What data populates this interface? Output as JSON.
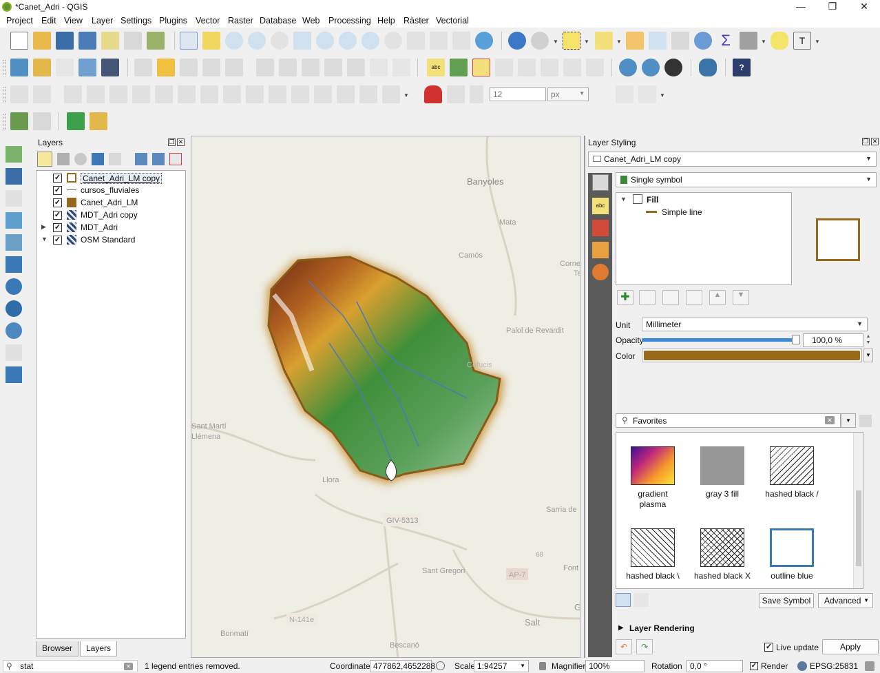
{
  "window": {
    "title": "*Canet_Adri - QGIS",
    "controls": {
      "minimize": "—",
      "restore": "❐",
      "close": "✕"
    }
  },
  "menubar": {
    "items": [
      "Project",
      "Edit",
      "View",
      "Layer",
      "Settings",
      "Plugins",
      "Vector",
      "Raster",
      "Database",
      "Web",
      "Processing",
      "Help",
      "Ràster",
      "Vectorial"
    ]
  },
  "digitizing": {
    "snap_tolerance": "12",
    "snap_unit": "px"
  },
  "layers_panel": {
    "title": "Layers",
    "items": [
      {
        "name": "Canet_Adri_LM copy",
        "checked": true,
        "symbol": "outline-brown",
        "expand": ""
      },
      {
        "name": "cursos_fluviales",
        "checked": true,
        "symbol": "line",
        "expand": ""
      },
      {
        "name": "Canet_Adri_LM",
        "checked": true,
        "symbol": "fill-brown",
        "expand": ""
      },
      {
        "name": "MDT_Adri copy",
        "checked": true,
        "symbol": "raster",
        "expand": ""
      },
      {
        "name": "MDT_Adri",
        "checked": true,
        "symbol": "raster",
        "expand": "▶"
      },
      {
        "name": "OSM Standard",
        "checked": true,
        "symbol": "raster",
        "expand": "▼"
      }
    ],
    "tabs": [
      "Browser",
      "Layers"
    ]
  },
  "map": {
    "labels": [
      "Banyoles",
      "Mata",
      "Camós",
      "Corne",
      "Te",
      "Palol de Revardit",
      "Sant Martí",
      "Llémena",
      "Llora",
      "GIV-5313",
      "Sarria de",
      "68",
      "AP-7",
      "Font",
      "Sant Gregori",
      "N-141e",
      "Salt",
      "Bonmatí",
      "Bescanó",
      "G",
      "Cefucis"
    ]
  },
  "styling": {
    "title": "Layer Styling",
    "layer": "Canet_Adri_LM copy",
    "renderer": "Single symbol",
    "tree": {
      "fill": "Fill",
      "sub": "Simple line"
    },
    "unit_label": "Unit",
    "unit": "Millimeter",
    "opacity_label": "Opacity",
    "opacity": "100,0 %",
    "opacity_fraction": 1.0,
    "color_label": "Color",
    "color": "#98691b",
    "search": "Favorites",
    "symbols": [
      {
        "name": "gradient\nplasma",
        "kind": "gradient"
      },
      {
        "name": "gray 3 fill",
        "kind": "gray"
      },
      {
        "name": "hashed black /",
        "kind": "hash-fwd"
      },
      {
        "name": "hashed black \\",
        "kind": "hash-back"
      },
      {
        "name": "hashed black X",
        "kind": "hash-x"
      },
      {
        "name": "outline blue",
        "kind": "outline-blue"
      }
    ],
    "save_symbol": "Save Symbol",
    "advanced": "Advanced",
    "layer_rendering": "Layer Rendering",
    "live_update": "Live update",
    "apply": "Apply"
  },
  "statusbar": {
    "locator": "stat",
    "message": "1 legend entries removed.",
    "coordinate_label": "Coordinate",
    "coordinate": "477862,4652288",
    "scale_label": "Scale",
    "scale": "1:94257",
    "magnifier_label": "Magnifier",
    "magnifier": "100%",
    "rotation_label": "Rotation",
    "rotation": "0,0 °",
    "render_label": "Render",
    "crs": "EPSG:25831"
  }
}
